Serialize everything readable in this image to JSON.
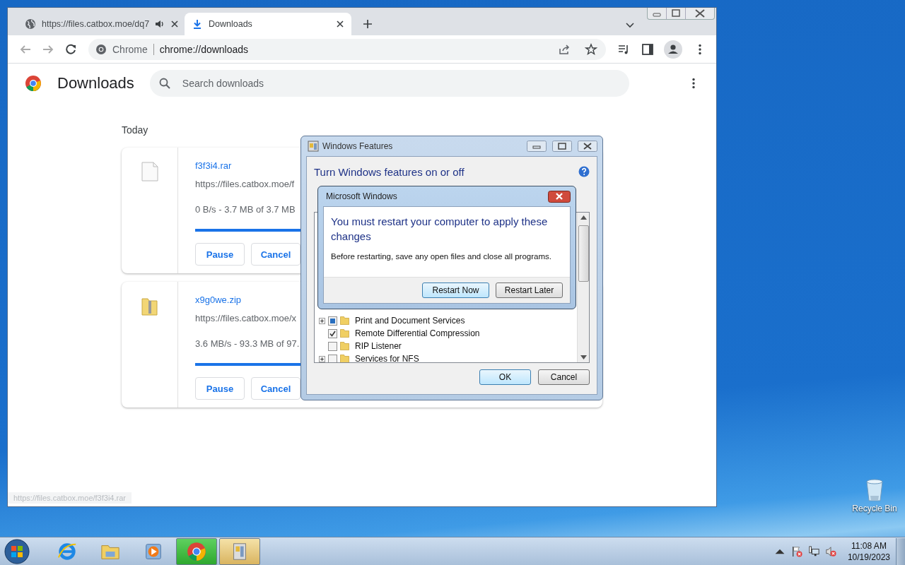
{
  "browser": {
    "tabs": [
      {
        "title": "https://files.catbox.moe/dq7",
        "kind": "web",
        "audio": true,
        "selected": false
      },
      {
        "title": "Downloads",
        "kind": "downloads",
        "audio": false,
        "selected": true
      }
    ],
    "omnibox": {
      "site_label": "Chrome",
      "url": "chrome://downloads"
    },
    "page": {
      "title": "Downloads",
      "search": {
        "placeholder": "Search downloads"
      },
      "section": "Today",
      "downloads": [
        {
          "name": "f3f3i4.rar",
          "kind": "file",
          "url": "https://files.catbox.moe/f",
          "status": "0 B/s - 3.7 MB of 3.7 MB",
          "level": 1,
          "buttons": [
            "Pause",
            "Cancel"
          ]
        },
        {
          "name": "x9g0we.zip",
          "kind": "zip",
          "url": "https://files.catbox.moe/x",
          "status": "3.6 MB/s - 93.3 MB of 97.",
          "level": 0.96,
          "buttons": [
            "Pause",
            "Cancel"
          ]
        }
      ]
    },
    "status_bubble": "https://files.catbox.moe/f3f3i4.rar"
  },
  "features_dialog": {
    "title": "Windows Features",
    "heading": "Turn Windows features on or off",
    "features": [
      {
        "label": "Print and Document Services",
        "expandable": true,
        "checked": false,
        "partial": true
      },
      {
        "label": "Remote Differential Compression",
        "expandable": false,
        "checked": true,
        "partial": false
      },
      {
        "label": "RIP Listener",
        "expandable": false,
        "checked": false,
        "partial": false
      },
      {
        "label": "Services for NFS",
        "expandable": true,
        "checked": false,
        "partial": false
      }
    ],
    "buttons": [
      "OK",
      "Cancel"
    ]
  },
  "message_box": {
    "title": "Microsoft Windows",
    "heading": "You must restart your computer to apply these changes",
    "body": "Before restarting, save any open files and close all programs.",
    "buttons": [
      {
        "label": "Restart Now",
        "default": true
      },
      {
        "label": "Restart Later",
        "default": false
      }
    ]
  },
  "desktop": {
    "icons": [
      {
        "label": "Recycle Bin",
        "kind": "recycle-bin"
      }
    ]
  },
  "taskbar": {
    "apps": [
      {
        "kind": "ie",
        "running": false
      },
      {
        "kind": "explorer",
        "running": false
      },
      {
        "kind": "media",
        "running": false
      },
      {
        "kind": "chrome",
        "running": true
      },
      {
        "kind": "features",
        "running": true
      }
    ],
    "clock": {
      "time": "11:08 AM",
      "date": "10/19/2023"
    }
  }
}
